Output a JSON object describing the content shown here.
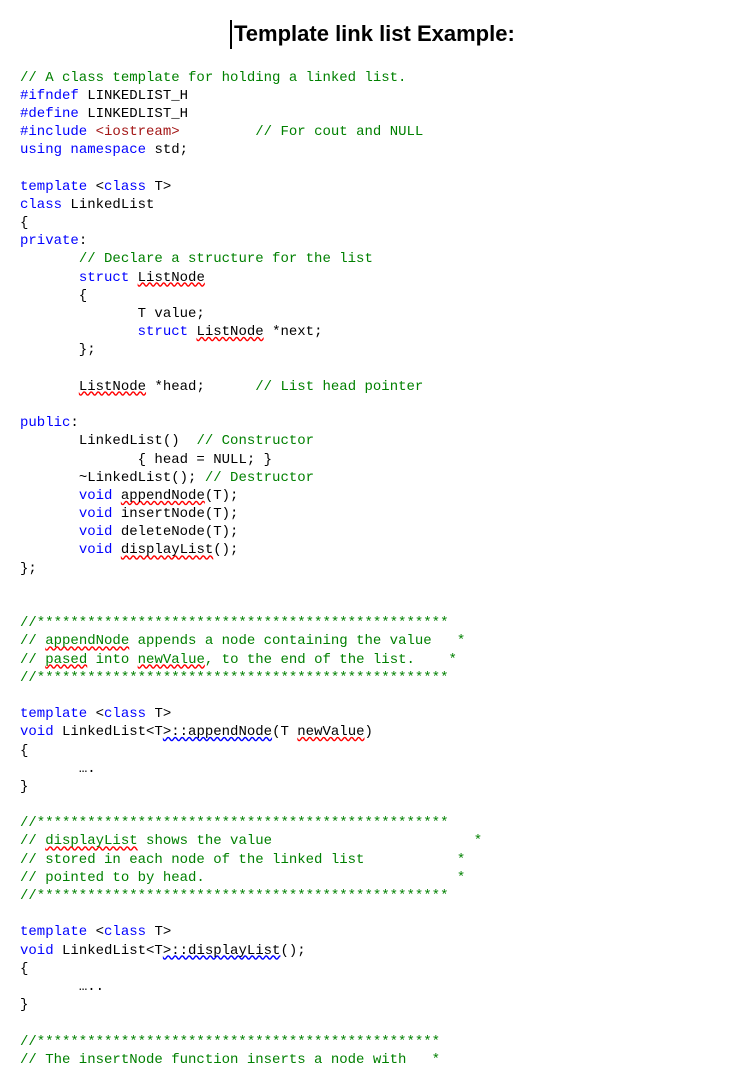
{
  "title": "Template link list Example:",
  "code": {
    "c1": "// A class template for holding a linked list.",
    "ifndef": "#ifndef",
    "guard": "LINKEDLIST_H",
    "define": "#define",
    "include": "#include",
    "incval": "<iostream>",
    "c2": "// For cout and NULL",
    "using": "using",
    "namespace": "namespace",
    "std": "std;",
    "template": "template",
    "class": "class",
    "T": "T",
    "LinkedList": "LinkedList",
    "private": "private",
    "c3": "// Declare a structure for the list",
    "struct": "struct",
    "ListNode": "ListNode",
    "value": "T value;",
    "next": "*next;",
    "head": "*head;",
    "c4": "// List head pointer",
    "public": "public",
    "ctor": "LinkedList()",
    "c5": "// Constructor",
    "ctorbody": "{ head = NULL; }",
    "dtor": "~LinkedList();",
    "c6": "// Destructor",
    "void": "void",
    "appendNode": "appendNode",
    "insertNode": "insertNode(T);",
    "deleteNode": "deleteNode(T);",
    "displayList": "displayList",
    "Targ": "(T);",
    "paren": "();",
    "star1": "//*************************************************",
    "c7a": "// ",
    "c7b": " appends a node containing the value   *",
    "c8a": "// ",
    "c8b": "pased",
    "c8c": " into ",
    "c8d": "newValue",
    "c8e": ", to the end of the list.    *",
    "LinkedListT": "LinkedList<T",
    "scopeApp": ">::appendNode",
    "newValue": "newValue",
    "Topen": "(T ",
    "close": ")",
    "dots1": "….",
    "c9a": "// ",
    "c9b": " shows the value                        *",
    "c10": "// stored in each node of the linked list           *",
    "c11": "// pointed to by head.                              *",
    "scopeDisp": ">::displayList",
    "dots2": "…..",
    "c12": "// The insertNode function inserts a node with   *",
    "star2": "//************************************************"
  }
}
